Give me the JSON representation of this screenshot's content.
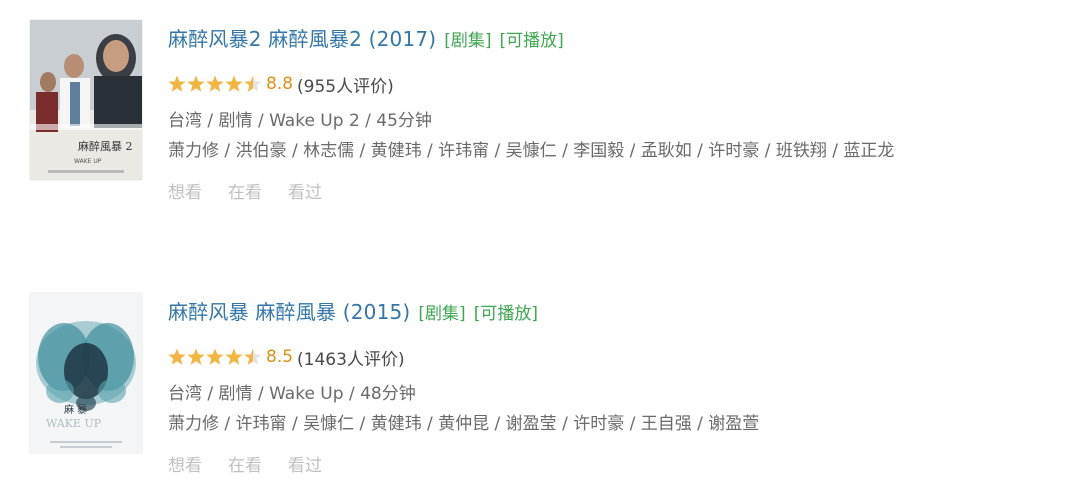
{
  "results": [
    {
      "title": "麻醉风暴2 麻醉風暴2 (2017)",
      "tags": [
        "[剧集]",
        "[可播放]"
      ],
      "rating_stars": 4.5,
      "score": "8.8",
      "rating_count": "(955人评价)",
      "meta": "台湾 / 剧情 / Wake Up 2 / 45分钟",
      "cast": "萧力修 / 洪伯豪 / 林志儒 / 黄健玮 / 许玮甯 / 吴慷仁 / 李国毅 / 孟耿如 / 许时豪 / 班铁翔 / 蓝正龙",
      "actions": [
        "想看",
        "在看",
        "看过"
      ],
      "poster": {
        "icon": "drama-poster-hospital",
        "colors": [
          "#e8e6e2",
          "#2d3440",
          "#8a9aa6"
        ]
      }
    },
    {
      "title": "麻醉风暴 麻醉風暴 (2015)",
      "tags": [
        "[剧集]",
        "[可播放]"
      ],
      "rating_stars": 4.5,
      "score": "8.5",
      "rating_count": "(1463人评价)",
      "meta": "台湾 / 剧情 / Wake Up / 48分钟",
      "cast": "萧力修 / 许玮甯 / 吴慷仁 / 黄健玮 / 黄仲昆 / 谢盈莹 / 许时豪 / 王自强 / 谢盈萱",
      "actions": [
        "想看",
        "在看",
        "看过"
      ],
      "poster": {
        "icon": "drama-poster-inkblot",
        "colors": [
          "#f2f4f6",
          "#3d8d9a",
          "#1e3040"
        ]
      }
    }
  ],
  "colors": {
    "title": "#3377aa",
    "tag": "#3ba94d",
    "score": "#e09015",
    "star": "#f4b53f",
    "muted": "#c0c0c0"
  }
}
